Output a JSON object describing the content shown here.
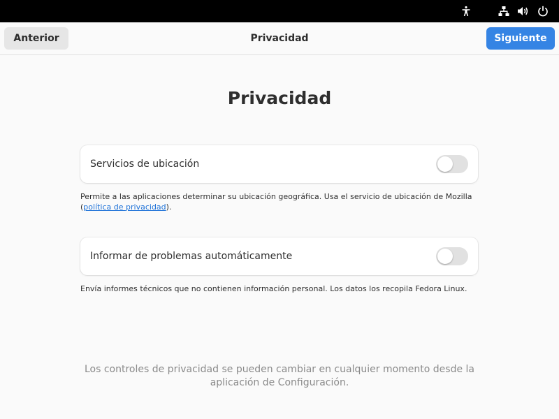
{
  "topbar": {
    "icons": [
      "accessibility-icon",
      "network-wired-icon",
      "volume-icon",
      "power-icon"
    ]
  },
  "header": {
    "back_label": "Anterior",
    "title": "Privacidad",
    "next_label": "Siguiente",
    "accent_color": "#3584e4"
  },
  "main": {
    "title": "Privacidad",
    "location": {
      "label": "Servicios de ubicación",
      "enabled": false,
      "description_prefix": "Permite a las aplicaciones determinar su ubicación geográfica. Usa el servicio de ubicación de Mozilla (",
      "policy_link": "política de privacidad",
      "description_suffix": ")."
    },
    "problems": {
      "label": "Informar de problemas automáticamente",
      "enabled": false,
      "description": "Envía informes técnicos que no contienen información personal. Los datos los recopila Fedora Linux."
    },
    "footer_note_line1": "Los controles de privacidad se pueden cambiar en cualquier momento desde la",
    "footer_note_line2": "aplicación de Configuración."
  }
}
